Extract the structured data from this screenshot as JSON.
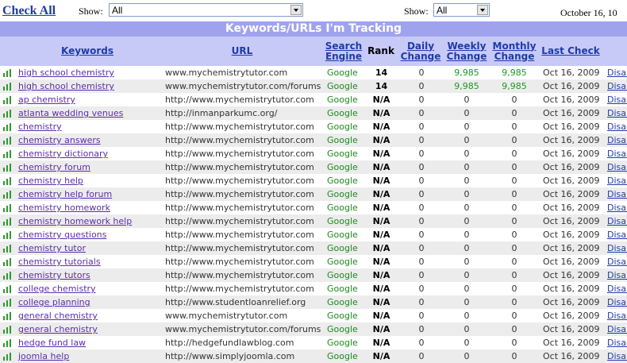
{
  "toolbar": {
    "check_all": "Check All",
    "show_label_1": "Show:",
    "show_value_1": "All",
    "show_label_2": "Show:",
    "show_value_2": "All",
    "date": "October 16, 10"
  },
  "table": {
    "title": "Keywords/URLs I'm Tracking",
    "headers": {
      "keywords": "Keywords",
      "url": "URL",
      "search_engine_1": "Search",
      "search_engine_2": "Engine",
      "rank": "Rank",
      "daily_1": "Daily",
      "daily_2": "Change",
      "weekly_1": "Weekly",
      "weekly_2": "Change",
      "monthly_1": "Monthly",
      "monthly_2": "Change",
      "last_check": "Last Check"
    },
    "action_label": "Disal",
    "rows": [
      {
        "keyword": "high school chemistry",
        "url": "www.mychemistrytutor.com",
        "engine": "Google",
        "rank": "14",
        "daily": "0",
        "weekly": "9,985",
        "monthly": "9,985",
        "last": "Oct 16, 2009"
      },
      {
        "keyword": "high school chemistry",
        "url": "www.mychemistrytutor.com/forums",
        "engine": "Google",
        "rank": "14",
        "daily": "0",
        "weekly": "9,985",
        "monthly": "9,985",
        "last": "Oct 16, 2009"
      },
      {
        "keyword": "ap chemistry",
        "url": "http://www.mychemistrytutor.com",
        "engine": "Google",
        "rank": "N/A",
        "daily": "0",
        "weekly": "0",
        "monthly": "0",
        "last": "Oct 16, 2009"
      },
      {
        "keyword": "atlanta wedding venues",
        "url": "http://inmanparkumc.org/",
        "engine": "Google",
        "rank": "N/A",
        "daily": "0",
        "weekly": "0",
        "monthly": "0",
        "last": "Oct 16, 2009"
      },
      {
        "keyword": "chemistry",
        "url": "http://www.mychemistrytutor.com",
        "engine": "Google",
        "rank": "N/A",
        "daily": "0",
        "weekly": "0",
        "monthly": "0",
        "last": "Oct 16, 2009"
      },
      {
        "keyword": "chemistry answers",
        "url": "http://www.mychemistrytutor.com",
        "engine": "Google",
        "rank": "N/A",
        "daily": "0",
        "weekly": "0",
        "monthly": "0",
        "last": "Oct 16, 2009"
      },
      {
        "keyword": "chemistry dictionary",
        "url": "http://www.mychemistrytutor.com",
        "engine": "Google",
        "rank": "N/A",
        "daily": "0",
        "weekly": "0",
        "monthly": "0",
        "last": "Oct 16, 2009"
      },
      {
        "keyword": "chemistry forum",
        "url": "http://www.mychemistrytutor.com",
        "engine": "Google",
        "rank": "N/A",
        "daily": "0",
        "weekly": "0",
        "monthly": "0",
        "last": "Oct 16, 2009"
      },
      {
        "keyword": "chemistry help",
        "url": "http://www.mychemistrytutor.com",
        "engine": "Google",
        "rank": "N/A",
        "daily": "0",
        "weekly": "0",
        "monthly": "0",
        "last": "Oct 16, 2009"
      },
      {
        "keyword": "chemistry help forum",
        "url": "http://www.mychemistrytutor.com",
        "engine": "Google",
        "rank": "N/A",
        "daily": "0",
        "weekly": "0",
        "monthly": "0",
        "last": "Oct 16, 2009"
      },
      {
        "keyword": "chemistry homework",
        "url": "http://www.mychemistrytutor.com",
        "engine": "Google",
        "rank": "N/A",
        "daily": "0",
        "weekly": "0",
        "monthly": "0",
        "last": "Oct 16, 2009"
      },
      {
        "keyword": "chemistry homework help",
        "url": "http://www.mychemistrytutor.com",
        "engine": "Google",
        "rank": "N/A",
        "daily": "0",
        "weekly": "0",
        "monthly": "0",
        "last": "Oct 16, 2009"
      },
      {
        "keyword": "chemistry questions",
        "url": "http://www.mychemistrytutor.com",
        "engine": "Google",
        "rank": "N/A",
        "daily": "0",
        "weekly": "0",
        "monthly": "0",
        "last": "Oct 16, 2009"
      },
      {
        "keyword": "chemistry tutor",
        "url": "http://www.mychemistrytutor.com",
        "engine": "Google",
        "rank": "N/A",
        "daily": "0",
        "weekly": "0",
        "monthly": "0",
        "last": "Oct 16, 2009"
      },
      {
        "keyword": "chemistry tutorials",
        "url": "http://www.mychemistrytutor.com",
        "engine": "Google",
        "rank": "N/A",
        "daily": "0",
        "weekly": "0",
        "monthly": "0",
        "last": "Oct 16, 2009"
      },
      {
        "keyword": "chemistry tutors",
        "url": "http://www.mychemistrytutor.com",
        "engine": "Google",
        "rank": "N/A",
        "daily": "0",
        "weekly": "0",
        "monthly": "0",
        "last": "Oct 16, 2009"
      },
      {
        "keyword": "college chemistry",
        "url": "http://www.mychemistrytutor.com",
        "engine": "Google",
        "rank": "N/A",
        "daily": "0",
        "weekly": "0",
        "monthly": "0",
        "last": "Oct 16, 2009"
      },
      {
        "keyword": "college planning",
        "url": "http://www.studentloanrelief.org",
        "engine": "Google",
        "rank": "N/A",
        "daily": "0",
        "weekly": "0",
        "monthly": "0",
        "last": "Oct 16, 2009"
      },
      {
        "keyword": "general chemistry",
        "url": "www.mychemistrytutor.com",
        "engine": "Google",
        "rank": "N/A",
        "daily": "0",
        "weekly": "0",
        "monthly": "0",
        "last": "Oct 16, 2009"
      },
      {
        "keyword": "general chemistry",
        "url": "www.mychemistrytutor.com/forums",
        "engine": "Google",
        "rank": "N/A",
        "daily": "0",
        "weekly": "0",
        "monthly": "0",
        "last": "Oct 16, 2009"
      },
      {
        "keyword": "hedge fund law",
        "url": "http://hedgefundlawblog.com",
        "engine": "Google",
        "rank": "N/A",
        "daily": "0",
        "weekly": "0",
        "monthly": "0",
        "last": "Oct 16, 2009"
      },
      {
        "keyword": "joomla help",
        "url": "http://www.simplyjoomla.com",
        "engine": "Google",
        "rank": "N/A",
        "daily": "0",
        "weekly": "0",
        "monthly": "0",
        "last": "Oct 16, 2009"
      }
    ]
  },
  "colors": {
    "title_bg": "#9fa3ee",
    "header_bg": "#c7c9f7",
    "link_blue": "#1f3ba8",
    "keyword_purple": "#5b2daa",
    "engine_green": "#1d8a1d",
    "alt_row": "#ececec"
  },
  "icons": {
    "row_icon": "bar-chart-icon",
    "dropdown": "chevron-down-icon"
  }
}
